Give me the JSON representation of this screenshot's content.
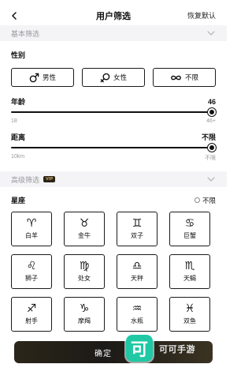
{
  "nav": {
    "title": "用户筛选",
    "reset_label": "恢复默认"
  },
  "basic": {
    "title": "基本筛选",
    "gender": {
      "label": "性别",
      "options": [
        {
          "label": "男性",
          "icon": "male-icon"
        },
        {
          "label": "女性",
          "icon": "female-icon"
        },
        {
          "label": "不限",
          "icon": "infinity-icon"
        }
      ]
    },
    "age": {
      "label": "年龄",
      "value": "46",
      "min_label": "18",
      "max_label": "46+",
      "level": 1.0
    },
    "distance": {
      "label": "距离",
      "value": "不限",
      "min_label": "10km",
      "max_label": "不限",
      "level": 1.0
    }
  },
  "advanced": {
    "title": "高级筛选",
    "badge": "VIP",
    "zodiac": {
      "label": "星座",
      "no_limit": "不限",
      "signs": [
        {
          "symbol": "♈",
          "name": "白羊"
        },
        {
          "symbol": "♉",
          "name": "金牛"
        },
        {
          "symbol": "♊",
          "name": "双子"
        },
        {
          "symbol": "♋",
          "name": "巨蟹"
        },
        {
          "symbol": "♌",
          "name": "狮子"
        },
        {
          "symbol": "♍",
          "name": "处女"
        },
        {
          "symbol": "♎",
          "name": "天秤"
        },
        {
          "symbol": "♏",
          "name": "天蝎"
        },
        {
          "symbol": "♐",
          "name": "射手"
        },
        {
          "symbol": "♑",
          "name": "摩羯"
        },
        {
          "symbol": "♒",
          "name": "水瓶"
        },
        {
          "symbol": "♓",
          "name": "双鱼"
        }
      ]
    }
  },
  "footer": {
    "confirm_label": "确定"
  },
  "watermark": {
    "icon_char": "可",
    "text": "可可手游"
  },
  "colors": {
    "accent": "#111111",
    "section_bg": "#f4f4f6",
    "muted": "#9a9aa0",
    "vip_bg": "#2a2418",
    "vip_fg": "#d8b86a",
    "watermark": "#1fc9a4"
  }
}
